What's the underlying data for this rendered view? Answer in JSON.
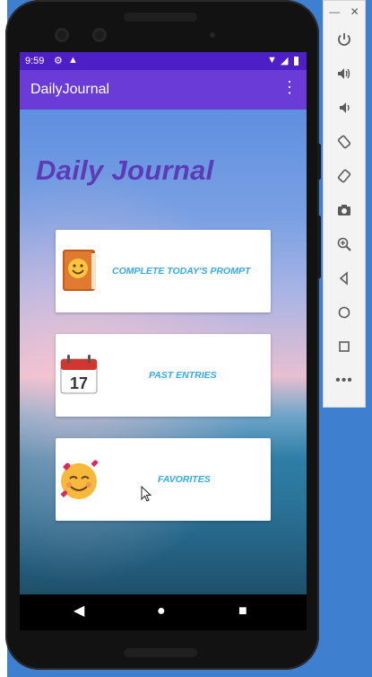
{
  "status_bar": {
    "time": "9:59",
    "left_icons": [
      "gear-icon",
      "warning-icon"
    ],
    "right_icons": [
      "wifi-icon",
      "signal-icon",
      "battery-icon"
    ]
  },
  "app_bar": {
    "title": "DailyJournal",
    "menu_icon": "overflow-menu-icon"
  },
  "main": {
    "headline": "Daily Journal",
    "buttons": [
      {
        "label": "COMPLETE TODAY'S PROMPT",
        "icon": "journal-book-icon"
      },
      {
        "label": "PAST ENTRIES",
        "icon": "calendar-icon",
        "icon_text": "17"
      },
      {
        "label": "FAVORITES",
        "icon": "smiling-face-with-hearts-icon"
      }
    ]
  },
  "nav_bar": {
    "items": [
      "back-icon",
      "home-icon",
      "recents-icon"
    ]
  },
  "emulator_panel": {
    "window_controls": [
      "minimize-icon",
      "close-icon"
    ],
    "tools": [
      "power-icon",
      "volume-up-icon",
      "volume-down-icon",
      "rotate-left-icon",
      "rotate-right-icon",
      "camera-icon",
      "zoom-icon",
      "back-icon",
      "home-icon",
      "overview-icon",
      "more-icon"
    ]
  },
  "colors": {
    "status_bar": "#4e1fc6",
    "app_bar": "#6a3bd6",
    "headline": "#5c3bb6",
    "button_text": "#36a9e8",
    "desktop_bg": "#3f7fd0"
  }
}
